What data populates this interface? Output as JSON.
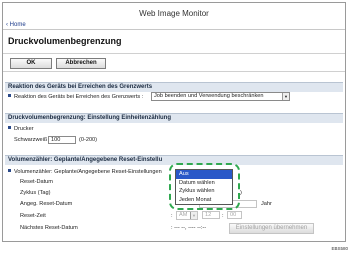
{
  "app": {
    "title": "Web Image Monitor",
    "home_link": "Home"
  },
  "page": {
    "title": "Druckvolumenbegrenzung"
  },
  "buttons": {
    "ok": "OK",
    "cancel": "Abbrechen"
  },
  "section1": {
    "header": "Reaktion des Geräts bei Erreichen des Grenzwerts",
    "label": "Reaktion des Geräts bei Erreichen des Grenzwerts :",
    "select_value": "Job beenden und Verwendung beschränken"
  },
  "section2": {
    "header": "Druckvolumenbegrenzung: Einstellung Einheitenzählung",
    "drucker_label": "Drucker",
    "sw_label": "Schwarzweiß :",
    "sw_value": "100",
    "sw_range": "(0-200)"
  },
  "section3": {
    "header": "Volumenzähler: Geplante/Angegebene Reset-Einstellu",
    "row_label": "Volumenzähler: Geplante/Angegebene Reset-Einstellungen",
    "reset_datum": "Reset-Datum",
    "zyklus": "Zyklus (Tag)",
    "zyklus_hint": ")",
    "angeg": "Angeg. Reset-Datum",
    "jahr": "Jahr",
    "reset_zeit": "Reset-Zeit",
    "ampm": "AM",
    "hour": "12",
    "minute": "00",
    "naechstes": "Nächstes Reset-Datum",
    "naechstes_value": ": --- --, ---- --:--",
    "apply_button": "Einstellungen übernehmen"
  },
  "dropdown": {
    "options": [
      "Aus",
      "Datum wählen",
      "Zyklus wählen",
      "Jeden Monat"
    ],
    "selected_index": 0
  },
  "figure_code": "EBS580"
}
